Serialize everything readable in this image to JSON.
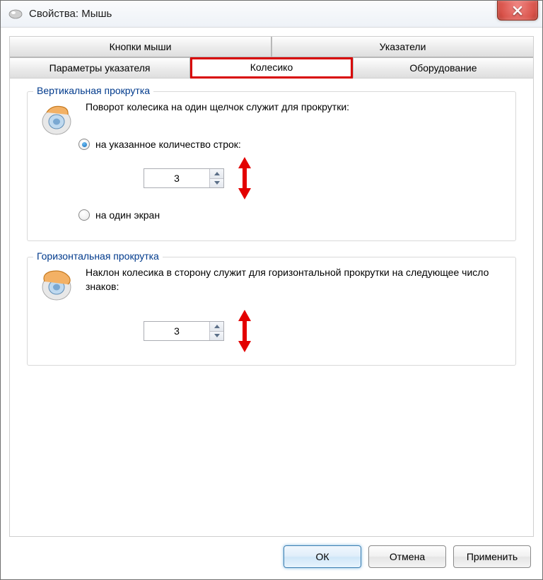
{
  "window": {
    "title": "Свойства: Мышь"
  },
  "tabs": {
    "row1": [
      {
        "label": "Кнопки мыши"
      },
      {
        "label": "Указатели"
      }
    ],
    "row2": [
      {
        "label": "Параметры указателя"
      },
      {
        "label": "Колесико",
        "active": true
      },
      {
        "label": "Оборудование"
      }
    ]
  },
  "vertical_group": {
    "legend": "Вертикальная прокрутка",
    "description": "Поворот колесика на один щелчок служит для прокрутки:",
    "radio_lines": {
      "label": "на указанное количество строк:",
      "selected": true
    },
    "radio_screen": {
      "label": "на один экран",
      "selected": false
    },
    "spin_value": "3"
  },
  "horizontal_group": {
    "legend": "Горизонтальная прокрутка",
    "description": "Наклон колесика в сторону служит для горизонтальной прокрутки на следующее число знаков:",
    "spin_value": "3"
  },
  "buttons": {
    "ok": "ОК",
    "cancel": "Отмена",
    "apply": "Применить"
  }
}
